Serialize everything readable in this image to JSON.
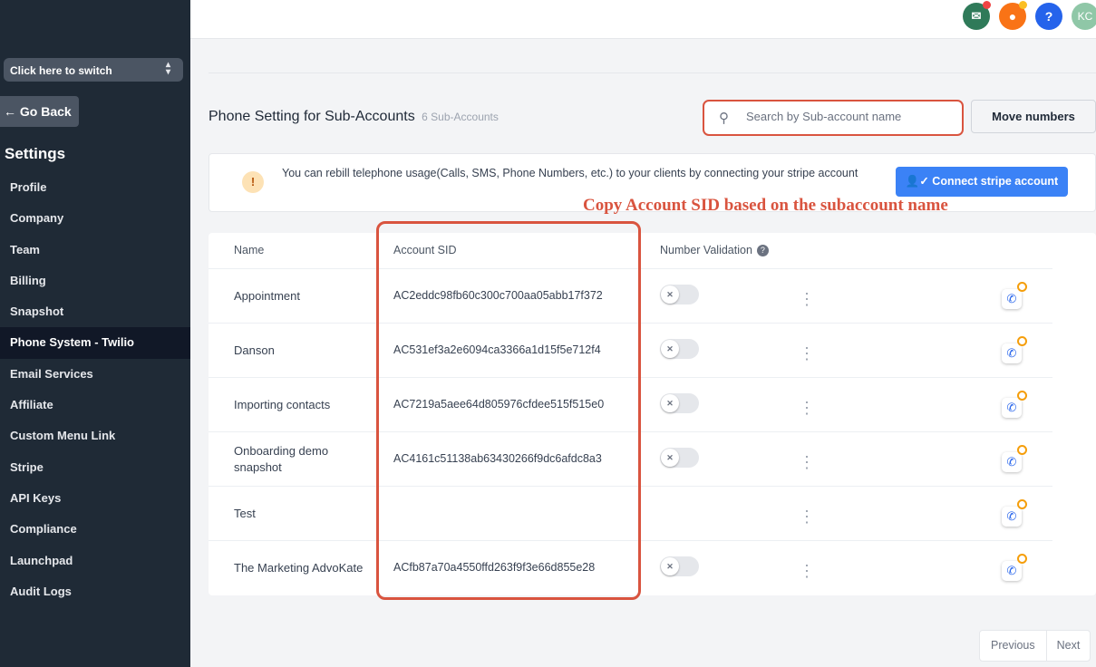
{
  "sidebar": {
    "switcher_label": "Click here to switch",
    "go_back": "← Go Back",
    "section_title": "Settings",
    "items": [
      {
        "label": "Profile"
      },
      {
        "label": "Company"
      },
      {
        "label": "Team"
      },
      {
        "label": "Billing"
      },
      {
        "label": "Snapshot"
      },
      {
        "label": "Phone System - Twilio",
        "active": true
      },
      {
        "label": "Email Services"
      },
      {
        "label": "Affiliate"
      },
      {
        "label": "Custom Menu Link"
      },
      {
        "label": "Stripe"
      },
      {
        "label": "API Keys"
      },
      {
        "label": "Compliance"
      },
      {
        "label": "Launchpad"
      },
      {
        "label": "Audit Logs"
      }
    ]
  },
  "topbar": {
    "icons": [
      {
        "name": "megaphone-icon",
        "glyph": "📢",
        "color": "#2f7a59"
      },
      {
        "name": "bell-icon",
        "glyph": "🔔",
        "color": "#f97316"
      },
      {
        "name": "help-icon",
        "glyph": "?",
        "color": "#2563eb"
      },
      {
        "name": "avatar",
        "glyph": "KC",
        "color": "#8fc7a7"
      }
    ]
  },
  "header": {
    "title": "Phone Setting for Sub-Accounts",
    "count": "6 Sub-Accounts"
  },
  "search": {
    "placeholder": "Search by Sub-account name"
  },
  "move_numbers_label": "Move numbers",
  "banner": {
    "text": "You can rebill telephone usage(Calls, SMS, Phone Numbers, etc.) to your clients by connecting your stripe account",
    "button_label": "Connect stripe account"
  },
  "annotation": "Copy Account SID based on the subaccount name",
  "table": {
    "columns": [
      "Name",
      "Account SID",
      "Number Validation"
    ],
    "rows": [
      {
        "name": "Appointment",
        "sid": "AC2eddc98fb60c300c700aa05abb17f372",
        "toggle": true
      },
      {
        "name": "Danson",
        "sid": "AC531ef3a2e6094ca3366a1d15f5e712f4",
        "toggle": true
      },
      {
        "name": "Importing contacts",
        "sid": "AC7219a5aee64d805976cfdee515f515e0",
        "toggle": true
      },
      {
        "name": "Onboarding demo snapshot",
        "sid": "AC4161c51138ab63430266f9dc6afdc8a3",
        "toggle": true
      },
      {
        "name": "Test",
        "sid": "",
        "toggle": false
      },
      {
        "name": "The Marketing AdvoKate",
        "sid": "ACfb87a70a4550ffd263f9f3e66d855e28",
        "toggle": true
      }
    ]
  },
  "pagination": {
    "previous": "Previous",
    "next": "Next"
  },
  "colors": {
    "sidebar_bg": "#1f2a36",
    "accent": "#3b82f6",
    "annotation": "#d9543f"
  }
}
